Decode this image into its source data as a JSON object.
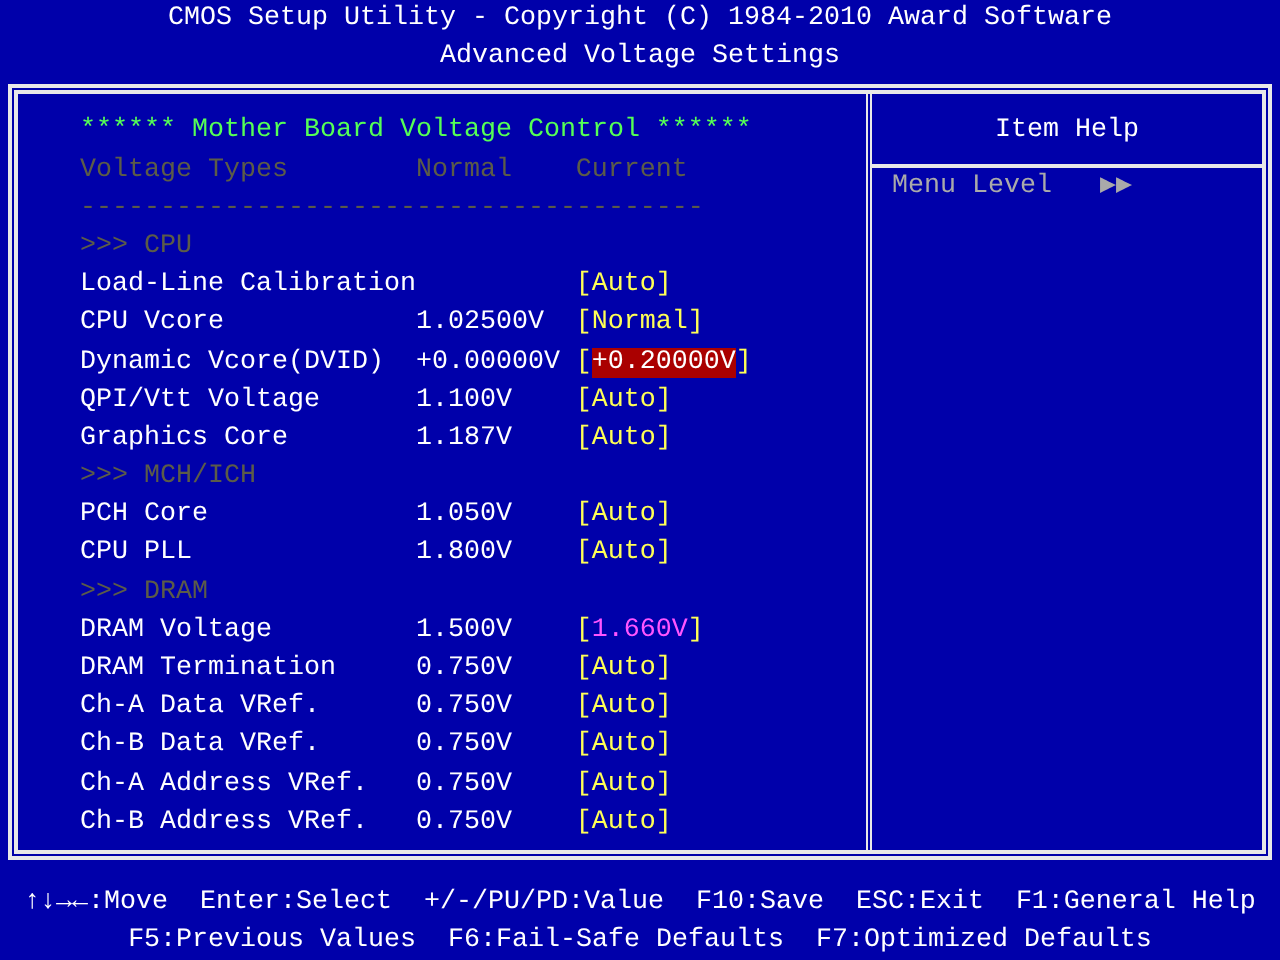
{
  "header": {
    "title": "CMOS Setup Utility - Copyright (C) 1984-2010 Award Software",
    "subtitle": "Advanced Voltage Settings"
  },
  "main": {
    "title": "****** Mother Board Voltage Control ******",
    "columns": [
      "Voltage Types",
      "Normal",
      "Current"
    ],
    "rule": "---------------------------------------",
    "rows": [
      {
        "kind": "section",
        "label": ">>> CPU"
      },
      {
        "kind": "setting",
        "label": "Load-Line Calibration",
        "value": "[Auto]",
        "color": "#ffff55",
        "selected": false
      },
      {
        "kind": "setting",
        "label": "CPU Vcore",
        "normal": "1.02500V",
        "value": "[Normal]",
        "color": "#ffff55",
        "selected": false
      },
      {
        "kind": "setting",
        "label": "Dynamic Vcore(DVID)",
        "normal": "+0.00000V",
        "value": "[+0.20000V]",
        "selected": true
      },
      {
        "kind": "setting",
        "label": "QPI/Vtt Voltage",
        "normal": "1.100V",
        "value": "[Auto]",
        "color": "#ffff55",
        "selected": false
      },
      {
        "kind": "setting",
        "label": "Graphics Core",
        "normal": "1.187V",
        "value": "[Auto]",
        "color": "#ffff55",
        "selected": false
      },
      {
        "kind": "section",
        "label": ">>> MCH/ICH"
      },
      {
        "kind": "setting",
        "label": "PCH Core",
        "normal": "1.050V",
        "value": "[Auto]",
        "color": "#ffff55",
        "selected": false
      },
      {
        "kind": "setting",
        "label": "CPU PLL",
        "normal": "1.800V",
        "value": "[Auto]",
        "color": "#ffff55",
        "selected": false
      },
      {
        "kind": "section",
        "label": ">>> DRAM"
      },
      {
        "kind": "setting",
        "label": "DRAM Voltage",
        "normal": "1.500V",
        "value": "[1.660V]",
        "color": "#ff55ff",
        "selected": false
      },
      {
        "kind": "setting",
        "label": "DRAM Termination",
        "normal": "0.750V",
        "value": "[Auto]",
        "color": "#ffff55",
        "selected": false
      },
      {
        "kind": "setting",
        "label": "Ch-A Data VRef.",
        "normal": "0.750V",
        "value": "[Auto]",
        "color": "#ffff55",
        "selected": false
      },
      {
        "kind": "setting",
        "label": "Ch-B Data VRef.",
        "normal": "0.750V",
        "value": "[Auto]",
        "color": "#ffff55",
        "selected": false
      },
      {
        "kind": "setting",
        "label": "Ch-A Address VRef.",
        "normal": "0.750V",
        "value": "[Auto]",
        "color": "#ffff55",
        "selected": false
      },
      {
        "kind": "setting",
        "label": "Ch-B Address VRef.",
        "normal": "0.750V",
        "value": "[Auto]",
        "color": "#ffff55",
        "selected": false
      }
    ]
  },
  "help": {
    "title": "Item Help",
    "label": "Menu Level",
    "marker": "▶▶"
  },
  "footer": [
    [
      "↑↓→←:Move",
      "Enter:Select",
      "+/-/PU/PD:Value",
      "F10:Save",
      "ESC:Exit",
      "F1:General Help"
    ],
    [
      "F5:Previous Values",
      "F6:Fail-Safe Defaults",
      "F7:Optimized Defaults"
    ]
  ]
}
